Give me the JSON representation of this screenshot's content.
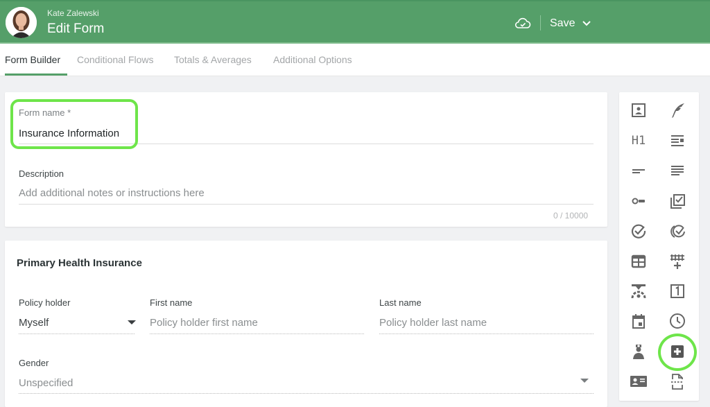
{
  "header": {
    "user_name": "Kate Zalewski",
    "title": "Edit Form",
    "save_label": "Save",
    "brand_color": "#559f69"
  },
  "tabs": [
    {
      "label": "Form Builder",
      "active": true
    },
    {
      "label": "Conditional Flows",
      "active": false
    },
    {
      "label": "Totals & Averages",
      "active": false
    },
    {
      "label": "Additional Options",
      "active": false
    }
  ],
  "form": {
    "name_label": "Form name *",
    "name_value": "Insurance Information",
    "description_label": "Description",
    "description_placeholder": "Add additional notes or instructions here",
    "description_counter": "0 / 10000"
  },
  "section": {
    "title": "Primary Health Insurance",
    "fields": {
      "policy_holder": {
        "label": "Policy holder",
        "value": "Myself"
      },
      "first_name": {
        "label": "First name",
        "placeholder": "Policy holder first name"
      },
      "last_name": {
        "label": "Last name",
        "placeholder": "Policy holder last name"
      },
      "gender": {
        "label": "Gender",
        "placeholder": "Unspecified"
      }
    }
  },
  "palette": {
    "h1_label": "H1",
    "items": [
      "contact-card-icon",
      "signature-icon",
      "heading-icon",
      "text-block-icon",
      "short-text-icon",
      "paragraph-icon",
      "toggle-icon",
      "multi-checkbox-icon",
      "check-circle-icon",
      "multi-check-circle-icon",
      "table-icon",
      "grid-add-icon",
      "scale-icon",
      "number-icon",
      "calendar-icon",
      "clock-icon",
      "doctor-icon",
      "medical-plus-icon",
      "id-card-icon",
      "page-break-icon"
    ],
    "highlight_color": "#6ee54a"
  }
}
